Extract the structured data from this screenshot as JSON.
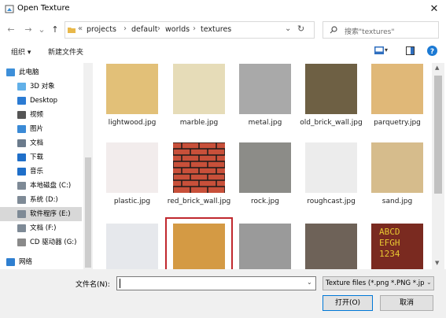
{
  "window": {
    "title": "Open Texture",
    "close": "✕"
  },
  "nav": {
    "back": "←",
    "forward": "→",
    "dropdown": "⌄",
    "up": "↑",
    "breadcrumb": [
      "«",
      "projects",
      "default",
      "worlds",
      "textures"
    ],
    "refresh": "↻",
    "search_placeholder": "搜索\"textures\""
  },
  "toolbar": {
    "organize": "组织 ▾",
    "new_folder": "新建文件夹"
  },
  "sidebar": {
    "items": [
      {
        "label": "此电脑",
        "icon": "computer-icon"
      },
      {
        "label": "3D 对象",
        "icon": "3d-objects-icon"
      },
      {
        "label": "Desktop",
        "icon": "desktop-icon"
      },
      {
        "label": "视频",
        "icon": "video-icon"
      },
      {
        "label": "图片",
        "icon": "pictures-icon"
      },
      {
        "label": "文档",
        "icon": "documents-icon"
      },
      {
        "label": "下载",
        "icon": "downloads-icon"
      },
      {
        "label": "音乐",
        "icon": "music-icon"
      },
      {
        "label": "本地磁盘 (C:)",
        "icon": "drive-icon"
      },
      {
        "label": "系统 (D:)",
        "icon": "drive-icon"
      },
      {
        "label": "软件程序 (E:)",
        "icon": "drive-icon"
      },
      {
        "label": "文档 (F:)",
        "icon": "drive-icon"
      },
      {
        "label": "CD 驱动器 (G:)",
        "icon": "cd-drive-icon"
      },
      {
        "label": "网络",
        "icon": "network-icon"
      }
    ]
  },
  "files": [
    {
      "name": "lightwood.jpg",
      "color": "#e2c078"
    },
    {
      "name": "marble.jpg",
      "color": "#e6dcb8"
    },
    {
      "name": "metal.jpg",
      "color": "#a9a9a9"
    },
    {
      "name": "old_brick_wall.jpg",
      "color": "#6e6044"
    },
    {
      "name": "parquetry.jpg",
      "color": "#e0b878"
    },
    {
      "name": "plastic.jpg",
      "color": "#f2ecec"
    },
    {
      "name": "red_brick_wall.jpg",
      "color": "#c04a32",
      "selected": true
    },
    {
      "name": "rock.jpg",
      "color": "#8c8c88"
    },
    {
      "name": "roughcast.jpg",
      "color": "#ececec"
    },
    {
      "name": "sand.jpg",
      "color": "#d6bc8c"
    },
    {
      "name": "",
      "color": "#e6e8ec"
    },
    {
      "name": "",
      "color": "#d49a44"
    },
    {
      "name": "",
      "color": "#9a9a9a"
    },
    {
      "name": "",
      "color": "#6e6258"
    },
    {
      "name": "",
      "color": "#7a2a20",
      "sign": "ABCD EFGH 1234"
    }
  ],
  "bottom": {
    "filename_label": "文件名(N):",
    "filename_value": "",
    "filter": "Texture files (*.png *.PNG *.jp",
    "open": "打开(O)",
    "cancel": "取消"
  }
}
